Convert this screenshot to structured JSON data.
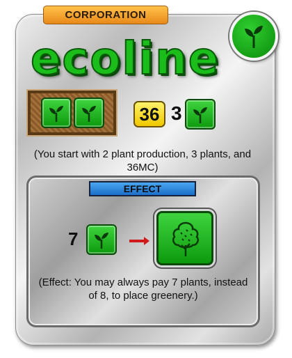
{
  "card": {
    "type_label": "CORPORATION",
    "tag_icon": "plant-icon",
    "name": "ecoline",
    "starting": {
      "production_icons": [
        "plant-icon",
        "plant-icon"
      ],
      "megacredits": "36",
      "plants_count": "3",
      "plants_icon": "plant-icon"
    },
    "start_description": "(You start with 2 plant production, 3 plants, and 36MC)",
    "effect": {
      "header": "EFFECT",
      "cost": "7",
      "cost_icon": "plant-icon",
      "result_icon": "greenery-tile-icon",
      "description": "(Effect: You may always pay 7 plants, instead of 8, to place greenery.)"
    }
  },
  "colors": {
    "accent_orange": "#e8891a",
    "plant_green": "#1bbd1b",
    "megacredit_yellow": "#f0c800",
    "effect_blue": "#1b6ec8",
    "arrow_red": "#d01a1a"
  }
}
